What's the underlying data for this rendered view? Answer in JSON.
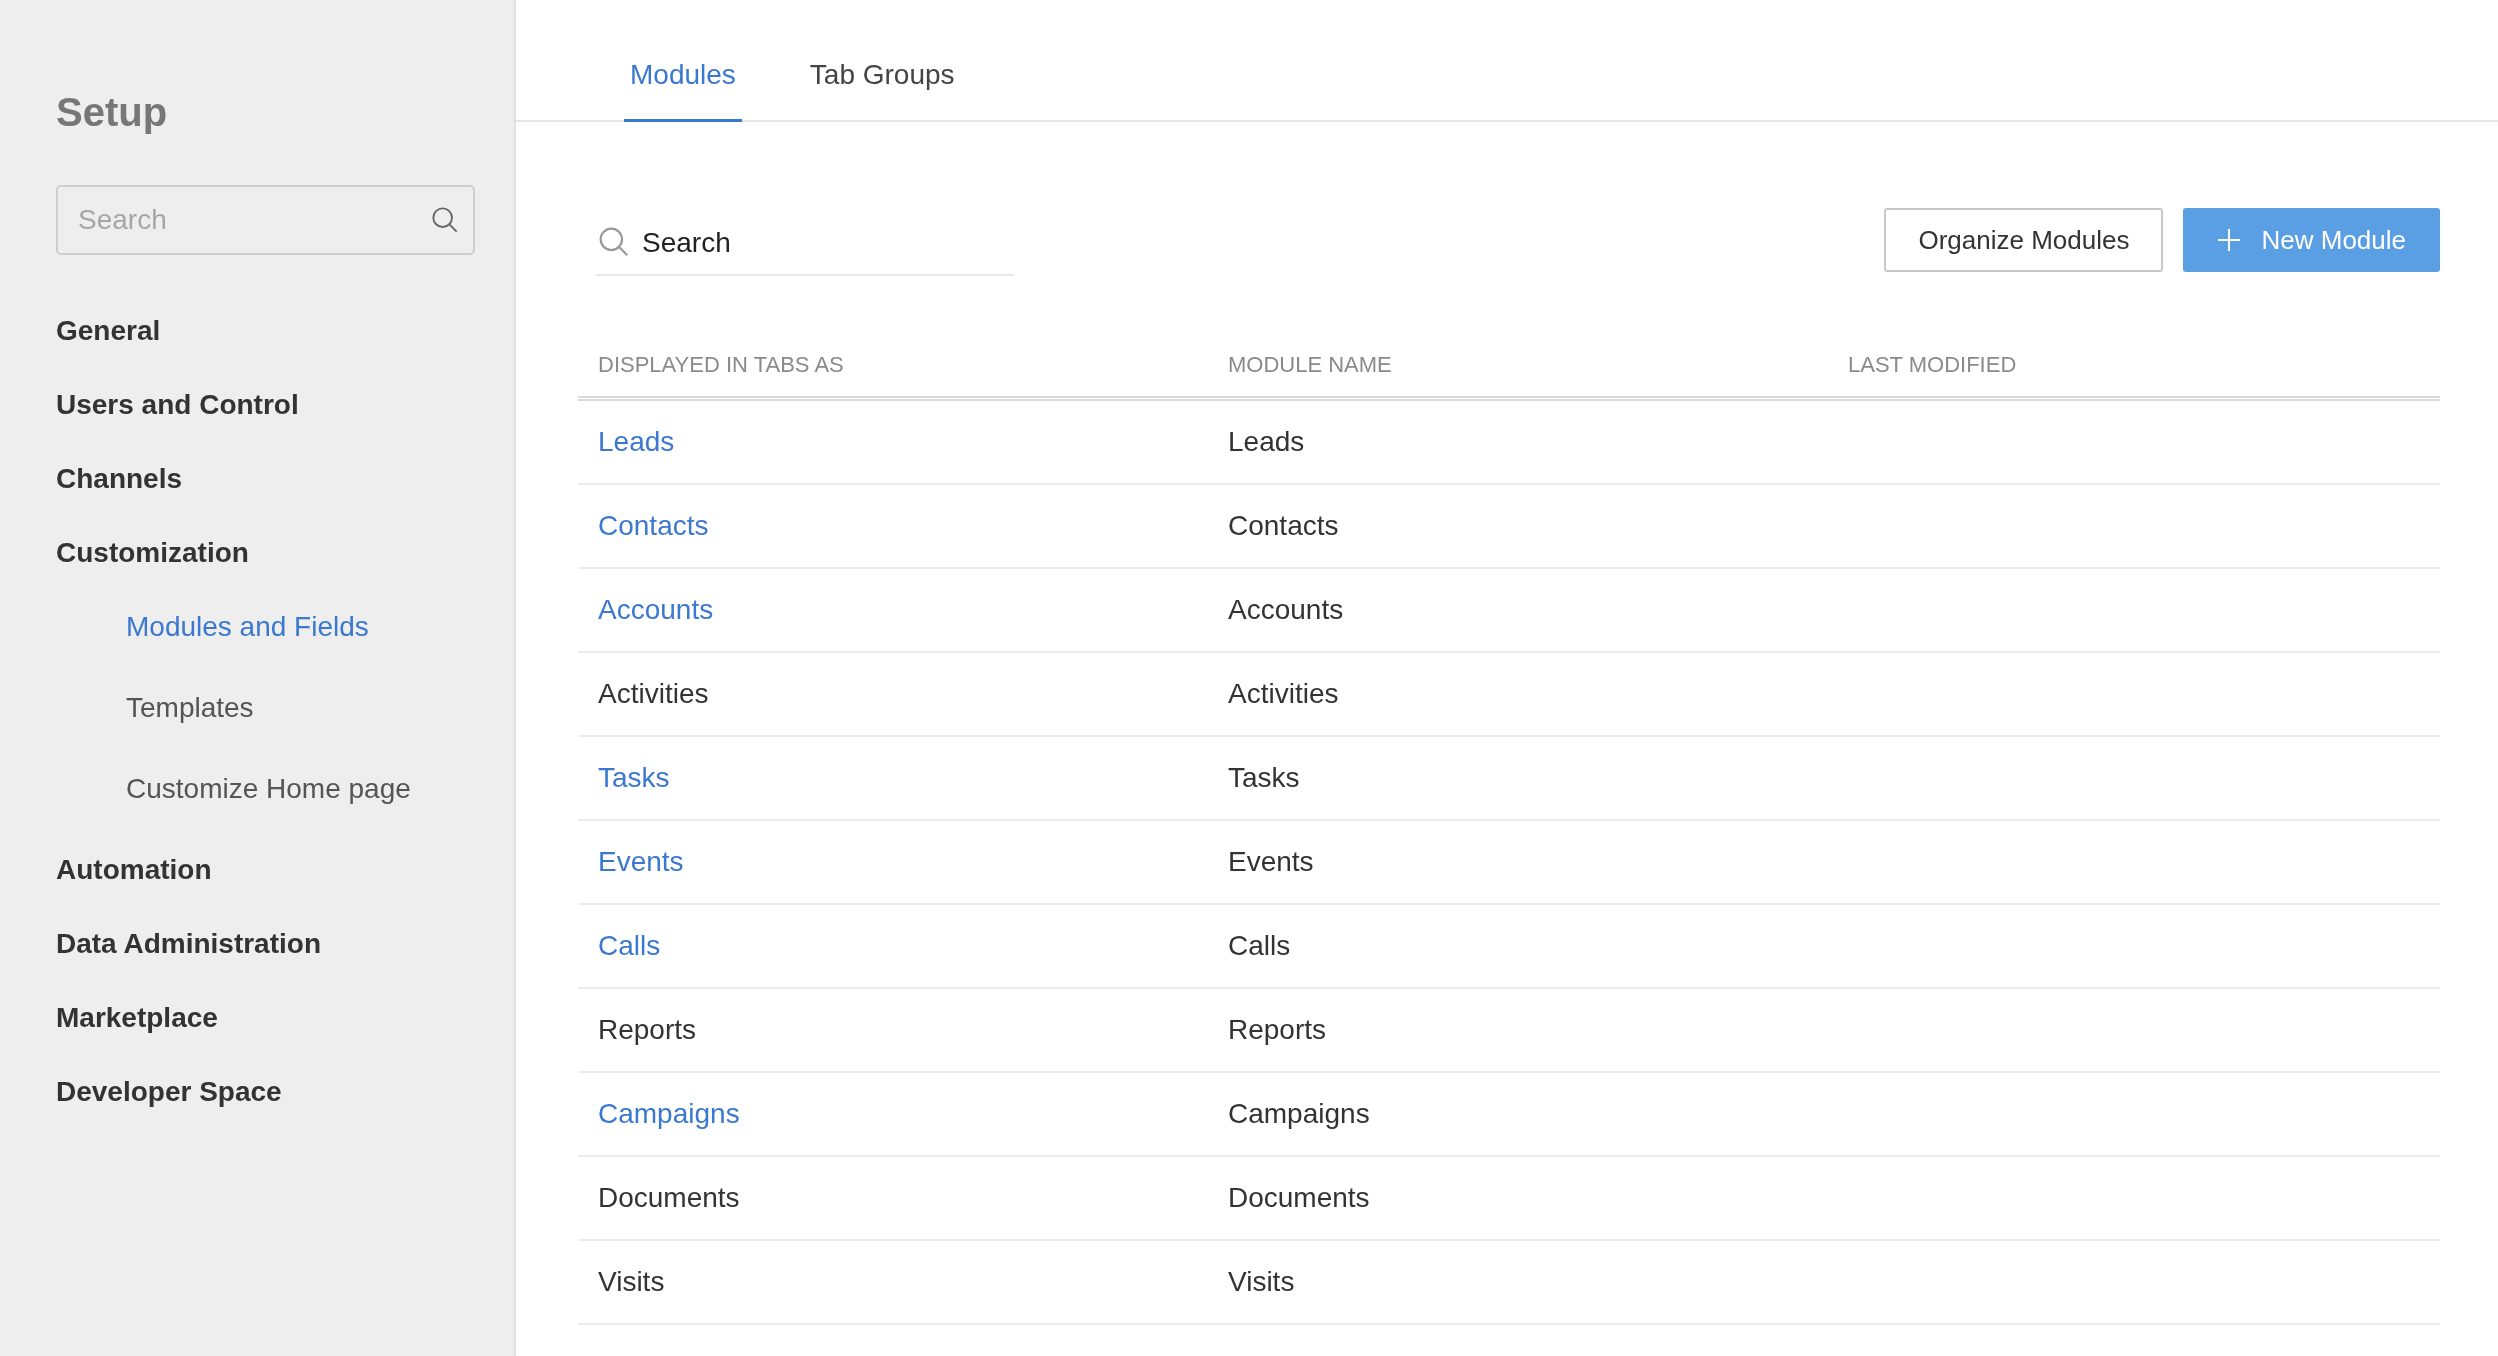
{
  "sidebar": {
    "title": "Setup",
    "search": {
      "placeholder": "Search"
    },
    "items": [
      {
        "label": "General",
        "selected": false
      },
      {
        "label": "Users and Control",
        "selected": false
      },
      {
        "label": "Channels",
        "selected": false
      },
      {
        "label": "Customization",
        "selected": false,
        "children": [
          {
            "label": "Modules and Fields",
            "selected": true
          },
          {
            "label": "Templates",
            "selected": false
          },
          {
            "label": "Customize Home page",
            "selected": false
          }
        ]
      },
      {
        "label": "Automation",
        "selected": false
      },
      {
        "label": "Data Administration",
        "selected": false
      },
      {
        "label": "Marketplace",
        "selected": false
      },
      {
        "label": "Developer Space",
        "selected": false
      }
    ]
  },
  "tabs": [
    {
      "label": "Modules",
      "selected": true
    },
    {
      "label": "Tab Groups",
      "selected": false
    }
  ],
  "search": {
    "placeholder": "Search"
  },
  "buttons": [
    {
      "label": "Organize Modules",
      "kind": "secondary"
    },
    {
      "label": "New Module",
      "kind": "primary"
    }
  ],
  "table": {
    "columns": [
      "DISPLAYED IN TABS AS",
      "MODULE NAME",
      "LAST MODIFIED"
    ],
    "rows": [
      {
        "display": "Leads",
        "linked": true,
        "module": "Leads"
      },
      {
        "display": "Contacts",
        "linked": true,
        "module": "Contacts"
      },
      {
        "display": "Accounts",
        "linked": true,
        "module": "Accounts"
      },
      {
        "display": "Activities",
        "linked": false,
        "module": "Activities"
      },
      {
        "display": "Tasks",
        "linked": true,
        "module": "Tasks"
      },
      {
        "display": "Events",
        "linked": true,
        "module": "Events"
      },
      {
        "display": "Calls",
        "linked": true,
        "module": "Calls"
      },
      {
        "display": "Reports",
        "linked": false,
        "module": "Reports"
      },
      {
        "display": "Campaigns",
        "linked": true,
        "module": "Campaigns"
      },
      {
        "display": "Documents",
        "linked": false,
        "module": "Documents"
      },
      {
        "display": "Visits",
        "linked": false,
        "module": "Visits"
      }
    ]
  }
}
